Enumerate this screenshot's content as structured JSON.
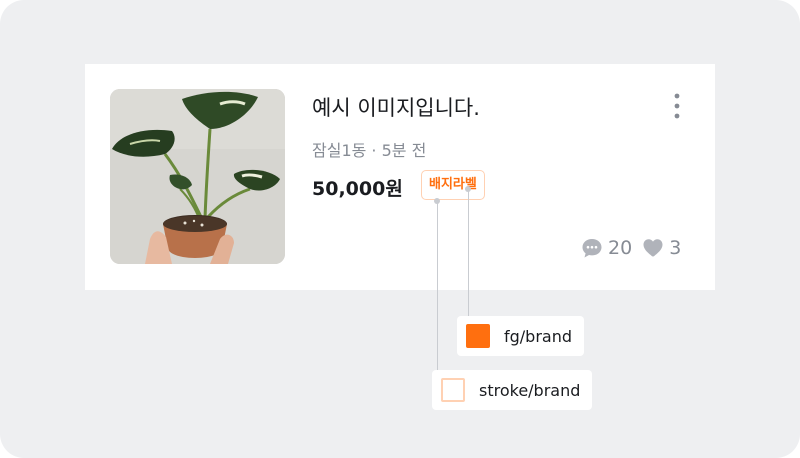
{
  "product_card": {
    "thumbnail_alt": "monstera plant in terracotta pot",
    "title": "예시 이미지입니다.",
    "meta": "잠실1동 · 5분 전",
    "price": "50,000원",
    "badge_label": "배지라벨",
    "more_icon": "more-vertical-icon",
    "stats": {
      "chat_icon": "chat-bubble-icon",
      "chat_count": "20",
      "like_icon": "heart-icon",
      "like_count": "3"
    }
  },
  "annotations": [
    {
      "label": "fg/brand",
      "color": "#ff6f0f",
      "style": "fill"
    },
    {
      "label": "stroke/brand",
      "color": "#ffd1b3",
      "style": "stroke"
    }
  ],
  "colors": {
    "background": "#eeeff1",
    "text_primary": "#1a1c20",
    "text_secondary": "#868b94",
    "brand": "#ff6f0f",
    "brand_stroke": "#ffd1b3"
  }
}
